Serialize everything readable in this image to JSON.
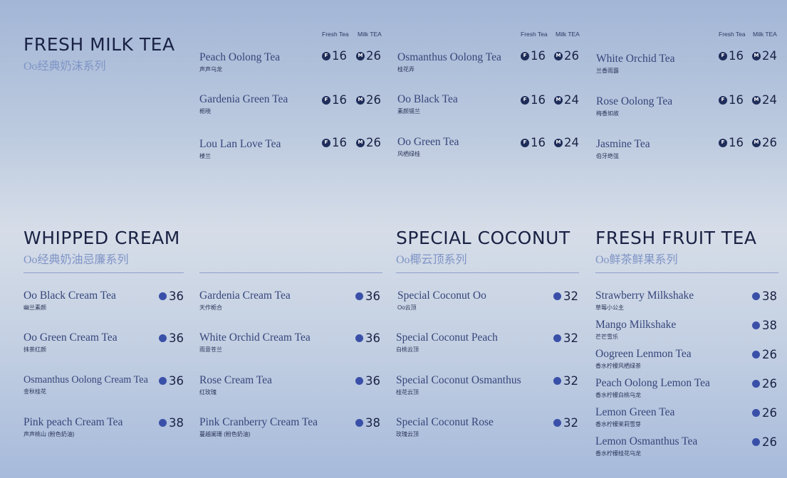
{
  "colors": {
    "title": "#1a2244",
    "subtitle": "#7f94c6",
    "item": "#36457a",
    "dot": "#3a50a8",
    "badge": "#1f2d5a"
  },
  "milk_tea": {
    "title": "FRESH MILK TEA",
    "subtitle": "Oo经典奶沫系列",
    "badge_fresh": "F",
    "badge_milk": "M",
    "columns": [
      {
        "head_fresh": "Fresh Tea",
        "head_milk": "Milk TEA",
        "items": [
          {
            "name": "Peach Oolong Tea",
            "cn": "声声乌龙",
            "fresh": "16",
            "milk": "26"
          },
          {
            "name": "Gardenia Green Tea",
            "cn": "栀晓",
            "fresh": "16",
            "milk": "26"
          },
          {
            "name": "Lou Lan Love Tea",
            "cn": "楼兰",
            "fresh": "16",
            "milk": "26"
          }
        ]
      },
      {
        "head_fresh": "Fresh Tea",
        "head_milk": "Milk TEA",
        "items": [
          {
            "name": "Osmanthus Oolong Tea",
            "cn": "桂花弄",
            "fresh": "16",
            "milk": "26"
          },
          {
            "name": "Oo Black Tea",
            "cn": "素颜锡兰",
            "fresh": "16",
            "milk": "24"
          },
          {
            "name": "Oo Green Tea",
            "cn": "风栖绿桂",
            "fresh": "16",
            "milk": "24"
          }
        ]
      },
      {
        "head_fresh": "Fresh Tea",
        "head_milk": "Milk TEA",
        "items": [
          {
            "name": "White Orchid Tea",
            "cn": "兰香雨露",
            "fresh": "16",
            "milk": "24"
          },
          {
            "name": "Rose Oolong Tea",
            "cn": "梅香如故",
            "fresh": "16",
            "milk": "24"
          },
          {
            "name": "Jasmine Tea",
            "cn": "伯牙绝弦",
            "fresh": "16",
            "milk": "26"
          }
        ]
      }
    ]
  },
  "whipped": {
    "title": "WHIPPED CREAM",
    "subtitle": "Oo经典奶油忌廉系列",
    "columns": [
      {
        "items": [
          {
            "name": "Oo Black Cream Tea",
            "cn": "幽兰素颜",
            "price": "36"
          },
          {
            "name": "Oo Green Cream Tea",
            "cn": "抹茶红颜",
            "price": "36"
          },
          {
            "name": "Osmanthus Oolong Cream Tea",
            "cn": "金秋桂花",
            "price": "36"
          },
          {
            "name": "Pink peach Cream Tea",
            "cn": "声声桃山 (粉色奶油)",
            "price": "38"
          }
        ]
      },
      {
        "items": [
          {
            "name": "Gardenia Cream Tea",
            "cn": "天作栀合",
            "price": "36"
          },
          {
            "name": "White Orchid Cream Tea",
            "cn": "雨意苍兰",
            "price": "36"
          },
          {
            "name": "Rose Cream Tea",
            "cn": "红玫瑰",
            "price": "36"
          },
          {
            "name": "Pink Cranberry Cream Tea",
            "cn": "蔓越阑珊 (粉色奶油)",
            "price": "38"
          }
        ]
      }
    ]
  },
  "coconut": {
    "title": "SPECIAL COCONUT",
    "subtitle": "Oo椰云顶系列",
    "items": [
      {
        "name": "Special Coconut Oo",
        "cn": "Oo云顶",
        "price": "32"
      },
      {
        "name": "Special Coconut Peach",
        "cn": "白桃云顶",
        "price": "32"
      },
      {
        "name": "Special Coconut Osmanthus",
        "cn": "桂花云顶",
        "price": "32"
      },
      {
        "name": "Special Coconut Rose",
        "cn": "玫瑰云顶",
        "price": "32"
      }
    ]
  },
  "fruit": {
    "title": "FRESH FRUIT TEA",
    "subtitle": "Oo鲜茶鲜果系列",
    "items": [
      {
        "name": "Strawberry  Milkshake",
        "cn": "草莓小公主",
        "price": "38"
      },
      {
        "name": "Mango Milkshake",
        "cn": "芒芒雪乐",
        "price": "38"
      },
      {
        "name": "Oogreen Lenmon Tea",
        "cn": "香水柠檬风栖绿茶",
        "price": "26"
      },
      {
        "name": "Peach Oolong Lemon Tea",
        "cn": "香水柠檬白桃乌龙",
        "price": "26"
      },
      {
        "name": "Lemon Green Tea",
        "cn": "香水柠檬茉莉雪芽",
        "price": "26"
      },
      {
        "name": "Lemon Osmanthus Tea",
        "cn": "香水柠檬桂花乌龙",
        "price": "26"
      }
    ]
  }
}
